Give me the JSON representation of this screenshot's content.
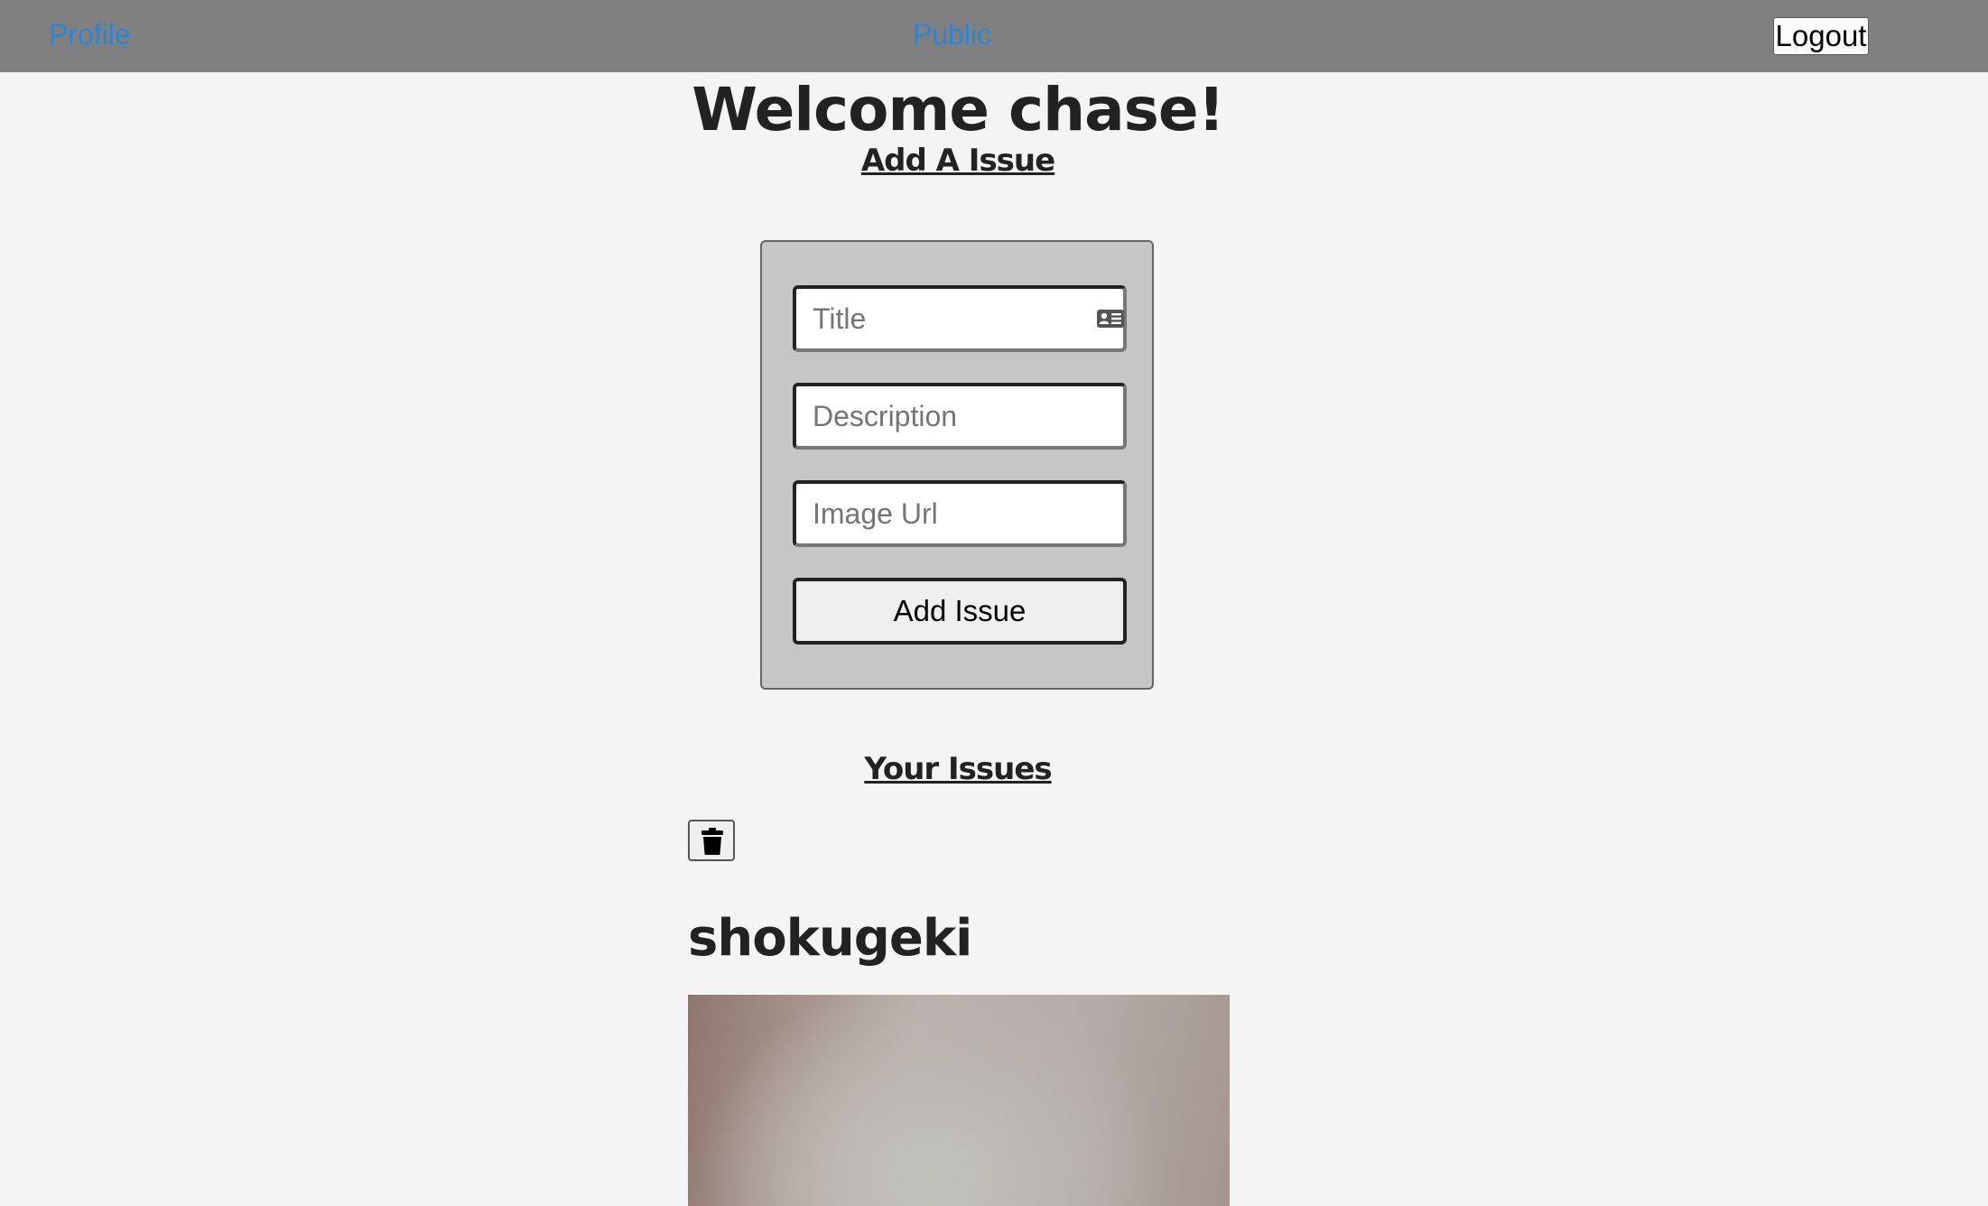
{
  "nav": {
    "profile": "Profile",
    "public": "Public",
    "logout": "Logout"
  },
  "welcome": "Welcome chase!",
  "add_heading": "Add A Issue",
  "form": {
    "title_placeholder": "Title",
    "title_value": "",
    "description_placeholder": "Description",
    "description_value": "",
    "image_url_placeholder": "Image Url",
    "image_url_value": "",
    "submit_label": "Add Issue"
  },
  "your_issues_heading": "Your Issues",
  "issues": [
    {
      "title": "shokugeki",
      "delete_icon": "trash-icon"
    }
  ],
  "colors": {
    "navbar_bg": "#808080",
    "nav_link": "#2f84d6",
    "page_bg": "#f4f4f4",
    "form_bg": "#c6c6c6"
  }
}
